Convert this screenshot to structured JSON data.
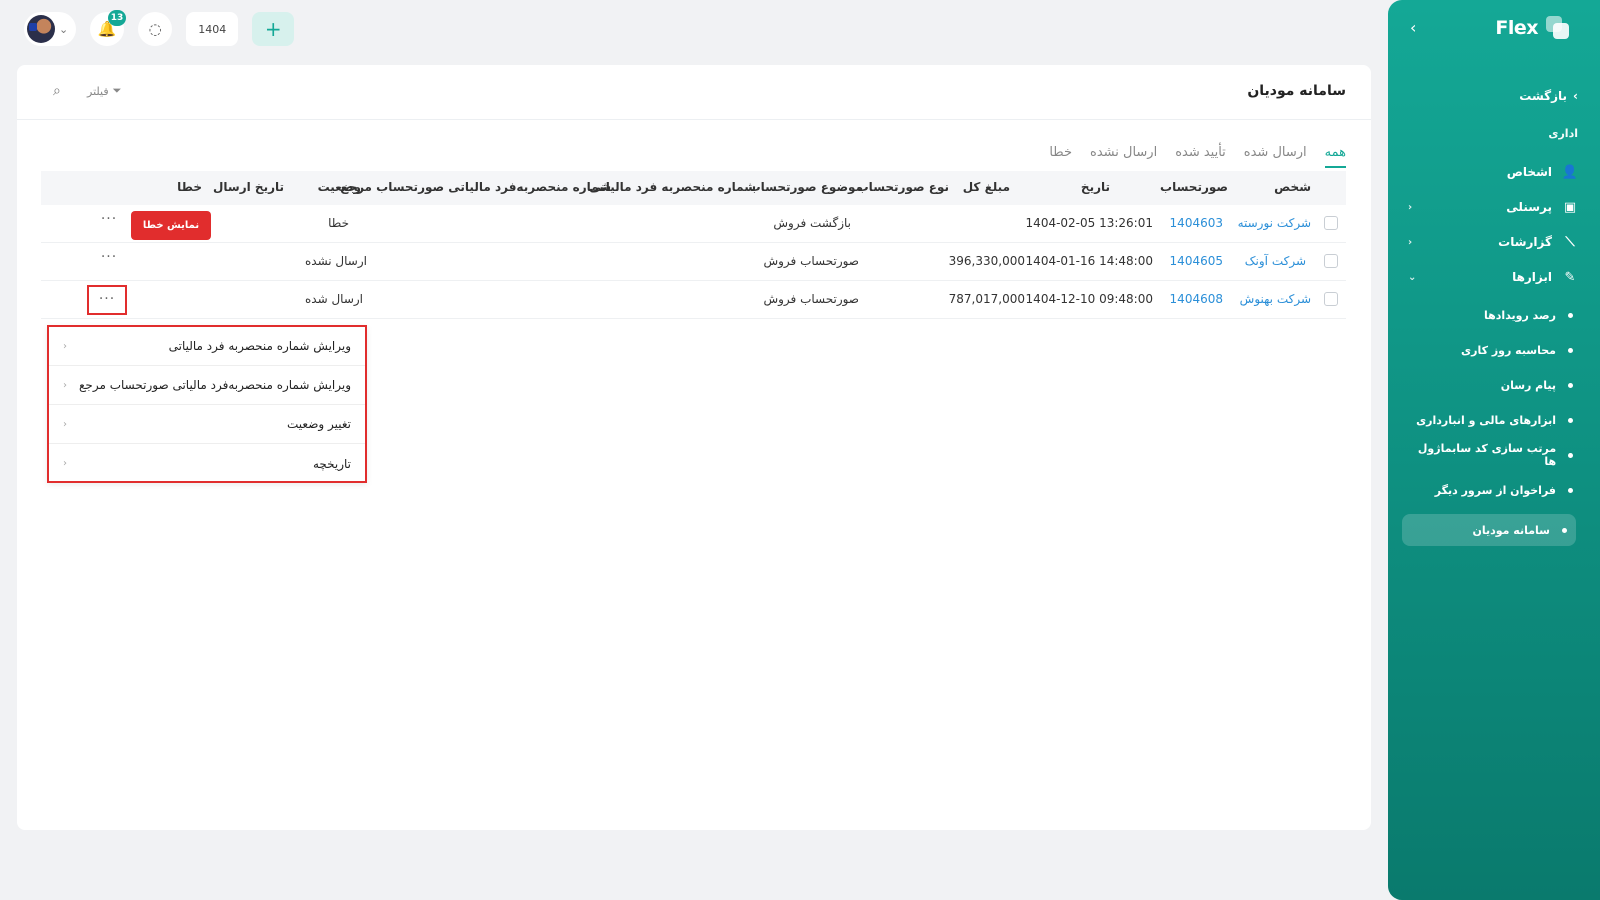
{
  "app": {
    "logo": "Flex"
  },
  "sidebar": {
    "back": "بازگشت",
    "section": "اداری",
    "items": [
      {
        "label": "اشخاص",
        "icon": "users-icon"
      },
      {
        "label": "پرسنلی",
        "icon": "id-card-icon"
      },
      {
        "label": "گزارشات",
        "icon": "chart-icon"
      },
      {
        "label": "ابزارها",
        "icon": "pencil-icon"
      }
    ],
    "tools": [
      "رصد رویدادها",
      "محاسبه روز کاری",
      "پیام رسان",
      "ابزارهای مالی و انبارداری",
      "مرتب سازی کد سابماژول ها",
      "فراخوان از سرور دیگر",
      "سامانه مودیان"
    ]
  },
  "topbar": {
    "notifications": "13",
    "year": "1404",
    "add": "+"
  },
  "page": {
    "title": "سامانه مودیان",
    "filter": "فیلتر"
  },
  "tabs": [
    "همه",
    "ارسال شده",
    "تأیید شده",
    "ارسال نشده",
    "خطا"
  ],
  "table": {
    "headers": {
      "person": "شخص",
      "invoice": "صورتحساب",
      "date": "تاریخ",
      "total": "مبلغ کل",
      "type": "نوع صورتحساب",
      "subject": "موضوع صورتحساب",
      "taxid": "شماره منحصربه فرد مالیاتی",
      "reftaxid": "شماره منحصربه‌فرد مالیاتی صورتحساب مرجع",
      "status": "وضعیت",
      "sent_date": "تاریخ ارسال",
      "error": "خطا"
    },
    "rows": [
      {
        "person": "شرکت نورسته",
        "invoice": "1404603",
        "date": "1404-02-05 13:26:01",
        "total": "",
        "subject": "بازگشت فروش",
        "status": "خطا",
        "error_button": "نمایش خطا"
      },
      {
        "person": "شرکت آونک",
        "invoice": "1404605",
        "date": "1404-01-16 14:48:00",
        "total": "396,330,000",
        "subject": "صورتحساب فروش",
        "status": "ارسال نشده",
        "error_button": ""
      },
      {
        "person": "شرکت بهنوش",
        "invoice": "1404608",
        "date": "1404-12-10 09:48:00",
        "total": "787,017,000",
        "subject": "صورتحساب فروش",
        "status": "ارسال شده",
        "error_button": ""
      }
    ],
    "more": "···"
  },
  "context_menu": [
    "ویرایش شماره منحصربه فرد مالیاتی",
    "ویرایش شماره منحصربه‌فرد مالیاتی صورتحساب مرجع",
    "تغییر وضعیت",
    "تاریخچه"
  ],
  "colors": {
    "accent": "#14a896",
    "error": "#e12d2d",
    "link": "#2b8fd8"
  }
}
